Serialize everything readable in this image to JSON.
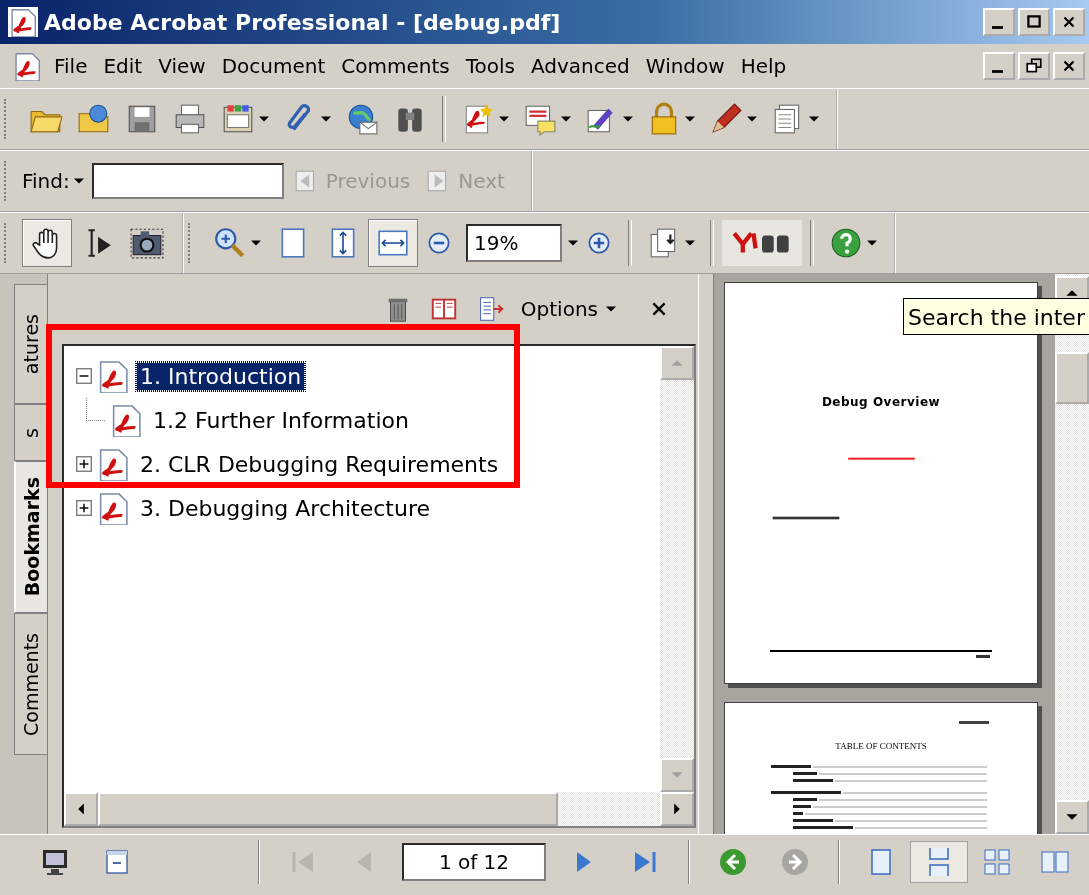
{
  "window": {
    "title": "Adobe Acrobat Professional - [debug.pdf]"
  },
  "menu": [
    "File",
    "Edit",
    "View",
    "Document",
    "Comments",
    "Tools",
    "Advanced",
    "Window",
    "Help"
  ],
  "find": {
    "label": "Find:",
    "previous": {
      "label": "Previous",
      "disabled": true
    },
    "next": {
      "label": "Next",
      "disabled": true
    }
  },
  "view_tools": [
    {
      "selected": true
    },
    {
      "selected": false
    },
    {
      "selected": false
    }
  ],
  "fit_buttons": [
    {
      "selected": false
    },
    {
      "selected": false
    },
    {
      "selected": true
    }
  ],
  "zoom": {
    "value": "19%"
  },
  "nav_tabs": [
    {
      "label": "atures",
      "selected": false
    },
    {
      "label": "s",
      "selected": false
    },
    {
      "label": "Bookmarks",
      "selected": true
    },
    {
      "label": "Comments",
      "selected": false
    }
  ],
  "bookmarks_panel": {
    "options": "Options"
  },
  "bookmarks": [
    {
      "title": "1. Introduction",
      "expanded": true,
      "selected": true,
      "children": [
        {
          "title": "1.2 Further Information",
          "selected": false
        }
      ]
    },
    {
      "title": "2. CLR Debugging Requirements",
      "expanded": false,
      "selected": false
    },
    {
      "title": "3. Debugging Architecture",
      "expanded": false,
      "selected": false
    }
  ],
  "pages": [
    {
      "kind": "cover",
      "title": "Debug Overview"
    },
    {
      "kind": "toc",
      "title": "TABLE OF CONTENTS"
    }
  ],
  "tooltip": "Search the inter",
  "status_bar": {
    "page": "1 of 12",
    "nav_buttons": [
      {
        "disabled": true
      },
      {
        "disabled": true
      },
      {
        "disabled": false
      },
      {
        "disabled": false
      }
    ],
    "history_buttons": [
      {
        "disabled": false
      },
      {
        "disabled": true
      }
    ],
    "layouts": [
      {
        "selected": false
      },
      {
        "selected": true
      },
      {
        "selected": false
      },
      {
        "selected": false
      }
    ]
  }
}
